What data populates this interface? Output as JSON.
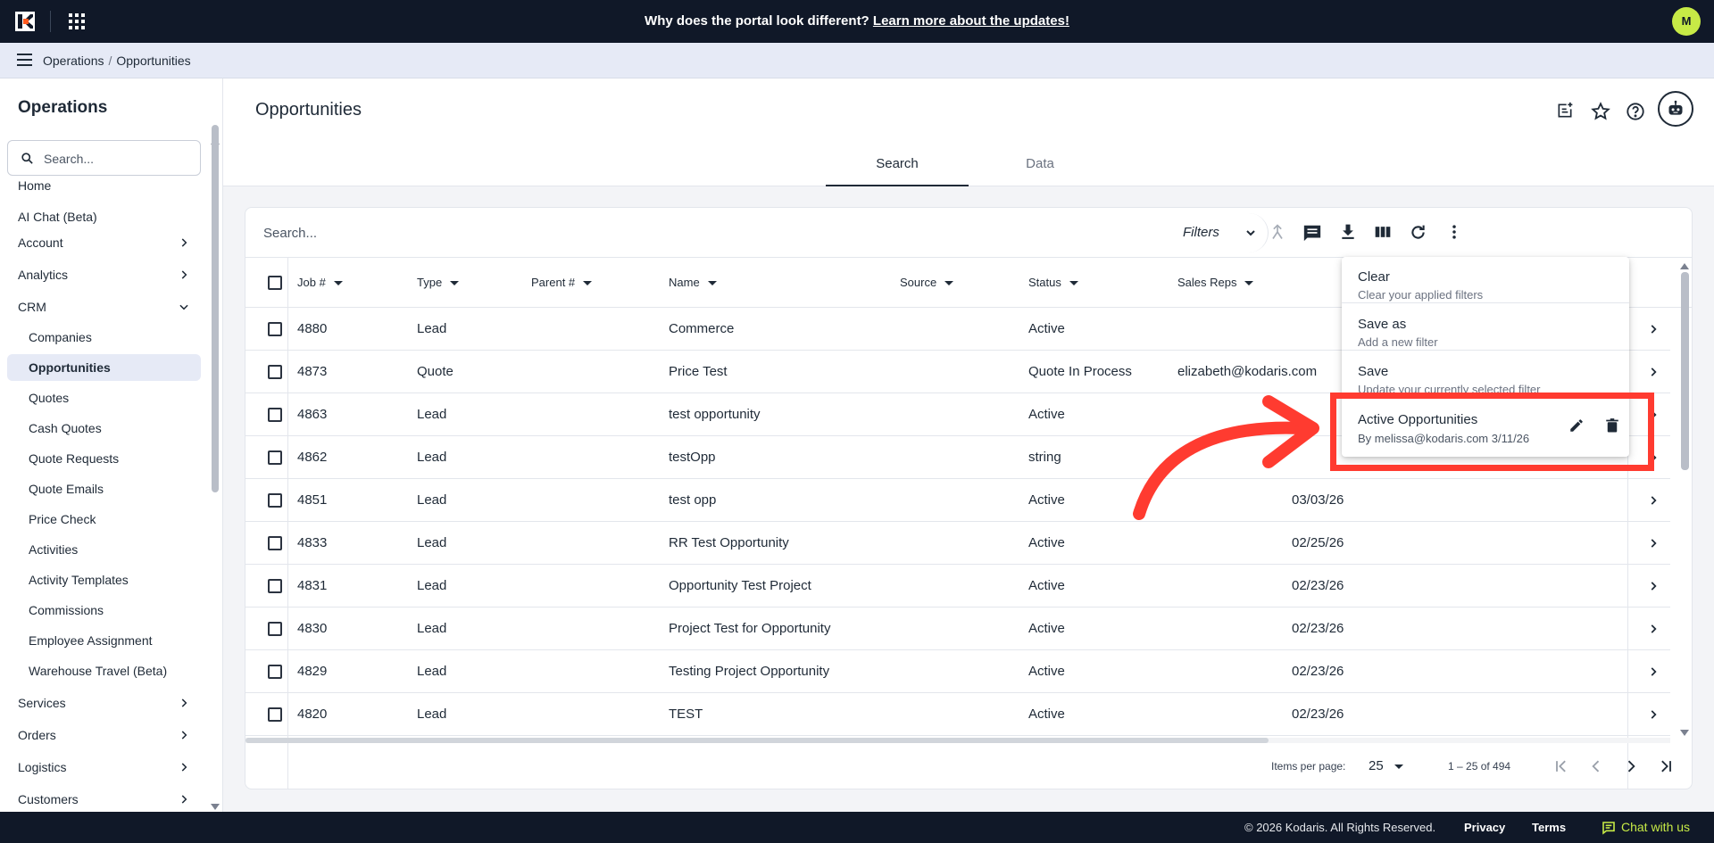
{
  "topbar": {
    "announcement_text": "Why does the portal look different?",
    "announcement_link": "Learn more about the updates!",
    "user_initial": "M",
    "colors": {
      "bg": "#101828",
      "avatar": "#c7ea46",
      "logo": "#ff5a1f"
    }
  },
  "breadcrumb": {
    "root": "Operations",
    "separator": "/",
    "current": "Opportunities"
  },
  "sidebar": {
    "title": "Operations",
    "search_placeholder": "Search...",
    "items": [
      {
        "label": "Home",
        "chevron": "none"
      },
      {
        "label": "AI Chat (Beta)",
        "chevron": "none"
      },
      {
        "label": "Account",
        "chevron": "right"
      },
      {
        "label": "Analytics",
        "chevron": "right"
      },
      {
        "label": "CRM",
        "chevron": "down"
      },
      {
        "label": "Companies",
        "sub": true
      },
      {
        "label": "Opportunities",
        "sub": true,
        "active": true
      },
      {
        "label": "Quotes",
        "sub": true
      },
      {
        "label": "Cash Quotes",
        "sub": true
      },
      {
        "label": "Quote Requests",
        "sub": true
      },
      {
        "label": "Quote Emails",
        "sub": true
      },
      {
        "label": "Price Check",
        "sub": true
      },
      {
        "label": "Activities",
        "sub": true
      },
      {
        "label": "Activity Templates",
        "sub": true
      },
      {
        "label": "Commissions",
        "sub": true
      },
      {
        "label": "Employee Assignment",
        "sub": true
      },
      {
        "label": "Warehouse Travel (Beta)",
        "sub": true
      },
      {
        "label": "Services",
        "chevron": "right"
      },
      {
        "label": "Orders",
        "chevron": "right"
      },
      {
        "label": "Logistics",
        "chevron": "right"
      },
      {
        "label": "Customers",
        "chevron": "right"
      }
    ]
  },
  "page": {
    "title": "Opportunities",
    "header_icons": [
      "add-note-icon",
      "star-icon",
      "help-icon",
      "bot-icon"
    ],
    "tabs": [
      {
        "label": "Search",
        "active": true
      },
      {
        "label": "Data",
        "active": false
      }
    ]
  },
  "toolbar": {
    "search_placeholder": "Search...",
    "filters_label": "Filters",
    "icons": [
      "merge-icon",
      "comment-icon",
      "download-icon",
      "columns-icon",
      "refresh-icon",
      "more-vert-icon"
    ]
  },
  "table": {
    "columns": [
      "Job #",
      "Type",
      "Parent #",
      "Name",
      "Source",
      "Status",
      "Sales Reps"
    ],
    "rows": [
      {
        "job": "4880",
        "type": "Lead",
        "parent": "",
        "name": "Commerce",
        "source": "",
        "status": "Active",
        "reps": "",
        "date": ""
      },
      {
        "job": "4873",
        "type": "Quote",
        "parent": "",
        "name": "Price Test",
        "source": "",
        "status": "Quote In Process",
        "reps": "elizabeth@kodaris.com",
        "date": ""
      },
      {
        "job": "4863",
        "type": "Lead",
        "parent": "",
        "name": "test opportunity",
        "source": "",
        "status": "Active",
        "reps": "",
        "date": ""
      },
      {
        "job": "4862",
        "type": "Lead",
        "parent": "",
        "name": "testOpp",
        "source": "",
        "status": "string",
        "reps": "",
        "date": ""
      },
      {
        "job": "4851",
        "type": "Lead",
        "parent": "",
        "name": "test opp",
        "source": "",
        "status": "Active",
        "reps": "",
        "date": "03/03/26"
      },
      {
        "job": "4833",
        "type": "Lead",
        "parent": "",
        "name": "RR Test Opportunity",
        "source": "",
        "status": "Active",
        "reps": "",
        "date": "02/25/26"
      },
      {
        "job": "4831",
        "type": "Lead",
        "parent": "",
        "name": "Opportunity Test Project",
        "source": "",
        "status": "Active",
        "reps": "",
        "date": "02/23/26"
      },
      {
        "job": "4830",
        "type": "Lead",
        "parent": "",
        "name": "Project Test for Opportunity",
        "source": "",
        "status": "Active",
        "reps": "",
        "date": "02/23/26"
      },
      {
        "job": "4829",
        "type": "Lead",
        "parent": "",
        "name": "Testing Project Opportunity",
        "source": "",
        "status": "Active",
        "reps": "",
        "date": "02/23/26"
      },
      {
        "job": "4820",
        "type": "Lead",
        "parent": "",
        "name": "TEST",
        "source": "",
        "status": "Active",
        "reps": "",
        "date": "02/23/26"
      }
    ]
  },
  "pagination": {
    "items_per_page_label": "Items per page:",
    "items_per_page_value": "25",
    "range_label": "1 – 25 of 494"
  },
  "filter_menu": {
    "items": [
      {
        "title": "Clear",
        "subtitle": "Clear your applied filters"
      },
      {
        "title": "Save as",
        "subtitle": "Add a new filter"
      },
      {
        "title": "Save",
        "subtitle": "Update your currently selected filter"
      }
    ],
    "saved_filter": {
      "title": "Active Opportunities",
      "subtitle": "By melissa@kodaris.com 3/11/26"
    }
  },
  "annotation": {
    "color": "#ff3b30"
  },
  "footer": {
    "copyright": "© 2026 Kodaris. All Rights Reserved.",
    "privacy": "Privacy",
    "terms": "Terms",
    "chat": "Chat with us"
  }
}
